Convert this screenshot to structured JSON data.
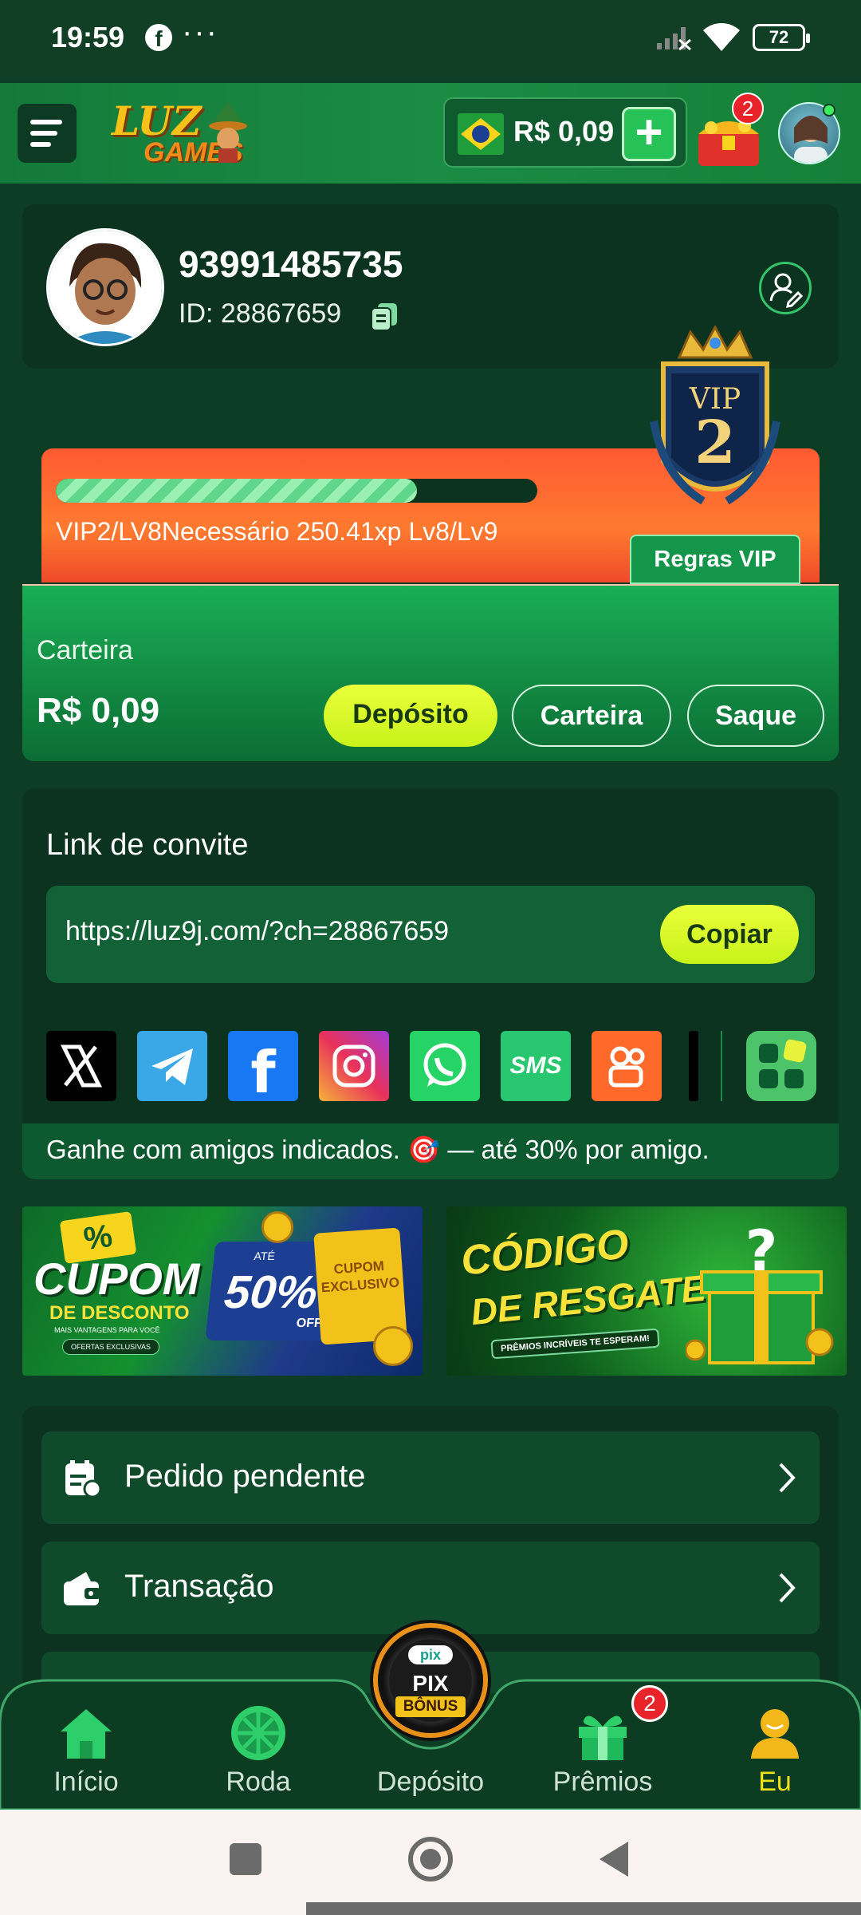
{
  "status_bar": {
    "time": "19:59",
    "dots": "···",
    "battery": "72"
  },
  "header": {
    "logo_line1": "LUZ",
    "logo_line2": "GAMES",
    "balance": "R$ 0,09",
    "plus": "+",
    "gift_badge": "2"
  },
  "profile": {
    "name": "93991485735",
    "id_text": "ID: 28867659"
  },
  "vip": {
    "progress": 0.75,
    "text": "VIP2/LV8Necessário 250.41xp Lv8/Lv9",
    "badge_label": "VIP",
    "badge_level": "2",
    "rules_button": "Regras VIP"
  },
  "wallet": {
    "label": "Carteira",
    "amount": "R$ 0,09",
    "deposit_button": "Depósito",
    "wallet_button": "Carteira",
    "withdraw_button": "Saque"
  },
  "invite": {
    "title": "Link de convite",
    "url": "https://luz9j.com/?ch=28867659",
    "copy_button": "Copiar",
    "footer": "Ganhe com amigos indicados. 🎯 — até 30% por amigo.",
    "social": [
      {
        "name": "x",
        "glyph": "𝕏"
      },
      {
        "name": "telegram",
        "glyph": ""
      },
      {
        "name": "facebook",
        "glyph": "f"
      },
      {
        "name": "instagram",
        "glyph": ""
      },
      {
        "name": "whatsapp",
        "glyph": ""
      },
      {
        "name": "sms",
        "glyph": "SMS"
      },
      {
        "name": "kwai",
        "glyph": ""
      }
    ]
  },
  "banners": {
    "cupom_title": "CUPOM",
    "cupom_sub": "DE DESCONTO",
    "cupom_small": "MAIS VANTAGENS PARA VOCÊ",
    "cupom_offers": "OFERTAS EXCLUSIVAS",
    "cupom_ate": "ATÉ",
    "cupom_pct": "50%",
    "cupom_off": "OFF",
    "cupom_ticket": "CUPOM EXCLUSIVO",
    "codigo_title": "CÓDIGO",
    "codigo_sub": "DE RESGATE",
    "codigo_small": "PRÊMIOS INCRÍVEIS TE ESPERAM!"
  },
  "menu": {
    "items": [
      {
        "label": "Pedido pendente"
      },
      {
        "label": "Transação"
      }
    ]
  },
  "bottom_nav": {
    "items": [
      {
        "label": "Início"
      },
      {
        "label": "Roda"
      },
      {
        "label": "Depósito"
      },
      {
        "label": "Prêmios"
      },
      {
        "label": "Eu"
      }
    ],
    "center_badge_top": "pix",
    "center_badge_main": "PIX",
    "center_badge_sub": "BÔNUS",
    "premios_badge": "2",
    "active_color": "#f2e21a"
  }
}
